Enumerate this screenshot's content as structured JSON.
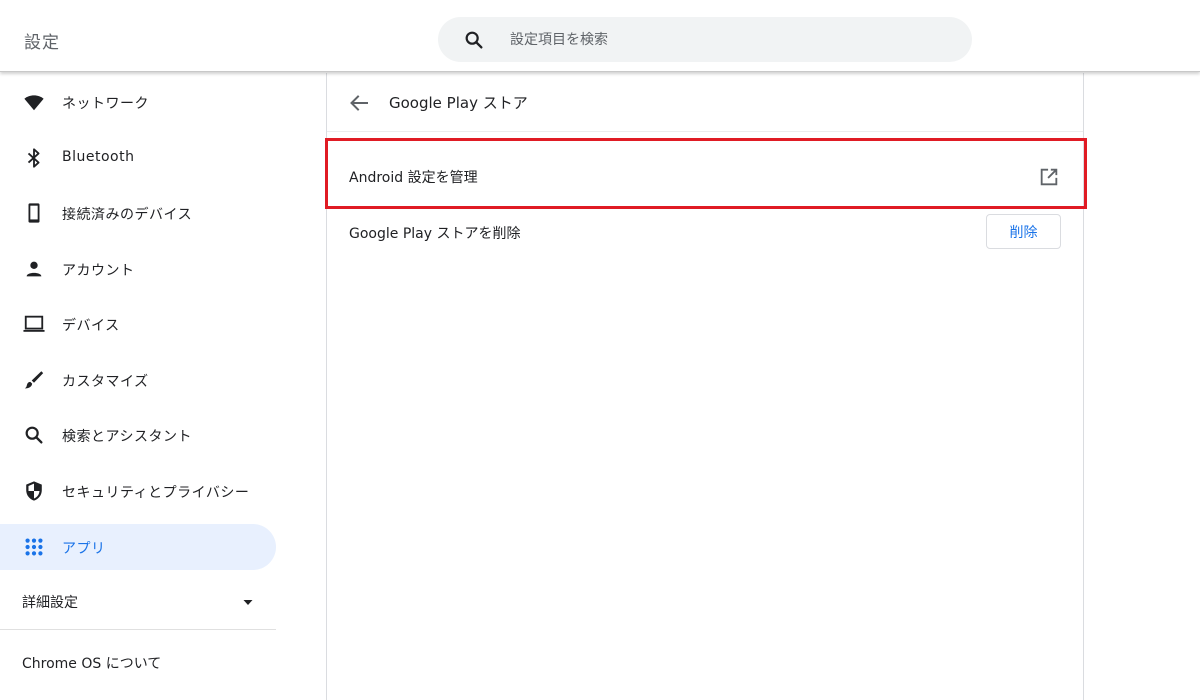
{
  "header": {
    "title": "設定",
    "search_placeholder": "設定項目を検索"
  },
  "sidebar": {
    "items": [
      {
        "label": "ネットワーク",
        "icon": "wifi-icon"
      },
      {
        "label": "Bluetooth",
        "icon": "bluetooth-icon"
      },
      {
        "label": "接続済みのデバイス",
        "icon": "phone-icon"
      },
      {
        "label": "アカウント",
        "icon": "person-icon"
      },
      {
        "label": "デバイス",
        "icon": "laptop-icon"
      },
      {
        "label": "カスタマイズ",
        "icon": "brush-icon"
      },
      {
        "label": "検索とアシスタント",
        "icon": "search-icon"
      },
      {
        "label": "セキュリティとプライバシー",
        "icon": "shield-icon"
      },
      {
        "label": "アプリ",
        "icon": "apps-grid-icon",
        "active": true
      }
    ],
    "advanced_label": "詳細設定",
    "about_label": "Chrome OS について"
  },
  "main": {
    "title": "Google Play ストア",
    "rows": {
      "android_settings": "Android 設定を管理",
      "remove_play_store": "Google Play ストアを削除",
      "remove_button": "削除"
    }
  },
  "colors": {
    "accent": "#1a73e8",
    "active_bg": "#e8f0fe",
    "highlight_border": "#e01b24"
  }
}
